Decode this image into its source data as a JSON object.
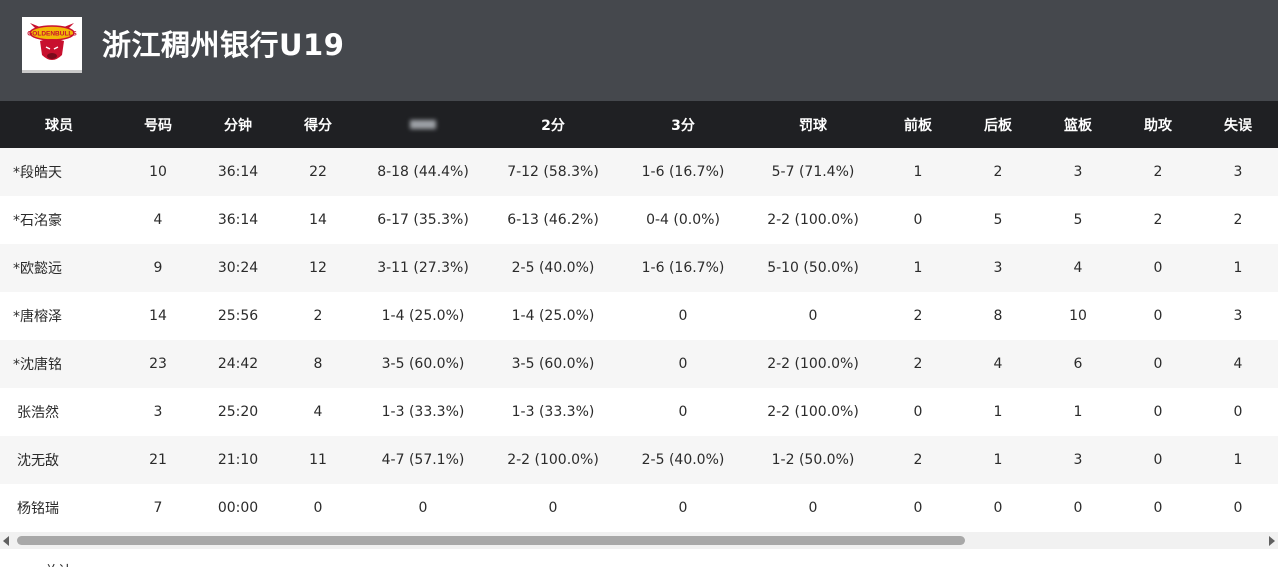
{
  "team": {
    "name": "浙江稠州银行U19",
    "logo_text": "GOLDENBULLS"
  },
  "table": {
    "headers": [
      "球员",
      "号码",
      "分钟",
      "得分",
      "",
      "2分",
      "3分",
      "罚球",
      "前板",
      "后板",
      "篮板",
      "助攻",
      "失误"
    ],
    "rows": [
      {
        "name": "*段皓天",
        "number": "10",
        "minutes": "36:14",
        "points": "22",
        "fg": "8-18 (44.4%)",
        "two": "7-12 (58.3%)",
        "three": "1-6 (16.7%)",
        "ft": "5-7 (71.4%)",
        "oreb": "1",
        "dreb": "2",
        "reb": "3",
        "ast": "2",
        "tov": "3"
      },
      {
        "name": "*石洺豪",
        "number": "4",
        "minutes": "36:14",
        "points": "14",
        "fg": "6-17 (35.3%)",
        "two": "6-13 (46.2%)",
        "three": "0-4 (0.0%)",
        "ft": "2-2 (100.0%)",
        "oreb": "0",
        "dreb": "5",
        "reb": "5",
        "ast": "2",
        "tov": "2"
      },
      {
        "name": "*欧懿远",
        "number": "9",
        "minutes": "30:24",
        "points": "12",
        "fg": "3-11 (27.3%)",
        "two": "2-5 (40.0%)",
        "three": "1-6 (16.7%)",
        "ft": "5-10 (50.0%)",
        "oreb": "1",
        "dreb": "3",
        "reb": "4",
        "ast": "0",
        "tov": "1"
      },
      {
        "name": "*唐榕泽",
        "number": "14",
        "minutes": "25:56",
        "points": "2",
        "fg": "1-4 (25.0%)",
        "two": "1-4 (25.0%)",
        "three": "0",
        "ft": "0",
        "oreb": "2",
        "dreb": "8",
        "reb": "10",
        "ast": "0",
        "tov": "3"
      },
      {
        "name": "*沈唐铭",
        "number": "23",
        "minutes": "24:42",
        "points": "8",
        "fg": "3-5 (60.0%)",
        "two": "3-5 (60.0%)",
        "three": "0",
        "ft": "2-2 (100.0%)",
        "oreb": "2",
        "dreb": "4",
        "reb": "6",
        "ast": "0",
        "tov": "4"
      },
      {
        "name": "张浩然",
        "number": "3",
        "minutes": "25:20",
        "points": "4",
        "fg": "1-3 (33.3%)",
        "two": "1-3 (33.3%)",
        "three": "0",
        "ft": "2-2 (100.0%)",
        "oreb": "0",
        "dreb": "1",
        "reb": "1",
        "ast": "0",
        "tov": "0"
      },
      {
        "name": "沈无敌",
        "number": "21",
        "minutes": "21:10",
        "points": "11",
        "fg": "4-7 (57.1%)",
        "two": "2-2 (100.0%)",
        "three": "2-5 (40.0%)",
        "ft": "1-2 (50.0%)",
        "oreb": "2",
        "dreb": "1",
        "reb": "3",
        "ast": "0",
        "tov": "1"
      },
      {
        "name": "杨铭瑞",
        "number": "7",
        "minutes": "00:00",
        "points": "0",
        "fg": "0",
        "two": "0",
        "three": "0",
        "ft": "0",
        "oreb": "0",
        "dreb": "0",
        "reb": "0",
        "ast": "0",
        "tov": "0"
      }
    ],
    "totals": {
      "name": "总计"
    }
  },
  "colors": {
    "header_bg": "#45484d",
    "table_header_bg": "#1f2023",
    "row_alt_bg": "#f6f6f6"
  }
}
